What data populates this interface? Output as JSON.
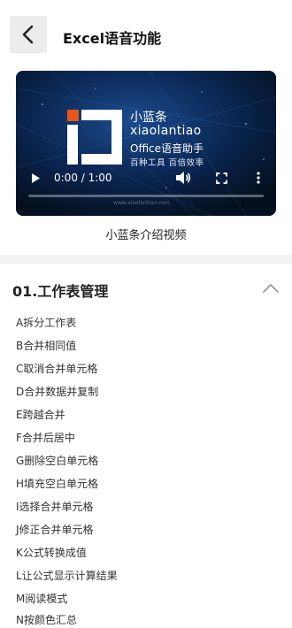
{
  "header": {
    "title": "Excel语音功能",
    "back_icon": "chevron-left-icon"
  },
  "video": {
    "brand_cn": "小蓝条",
    "brand_en": "xiaolantiao",
    "brand_tagline": "Office语音助手",
    "brand_slogan": "百种工具 百倍效率",
    "watermark": "www.xiaolantiao.com",
    "time_display": "0:00 / 1:00",
    "progress": 0,
    "icons": [
      "play-icon",
      "volume-icon",
      "fullscreen-icon",
      "more-vertical-icon"
    ],
    "caption": "小蓝条介绍视频"
  },
  "section": {
    "title": "01.工作表管理",
    "collapse_icon": "chevron-up-icon",
    "items": [
      "A拆分工作表",
      "B合并相同值",
      "C取消合并单元格",
      "D合并数据并复制",
      "E跨越合并",
      "F合并后居中",
      "G删除空白单元格",
      "H填充空白单元格",
      "I选择合并单元格",
      "J修正合并单元格",
      "K公式转换成值",
      "L让公式显示计算结果",
      "M阅读模式",
      "N按颜色汇总"
    ]
  },
  "colors": {
    "video_bg": "#06152e",
    "logo_orange": "#e9541c",
    "divider": "#f2f2f2",
    "back_button_bg": "#ececec"
  }
}
